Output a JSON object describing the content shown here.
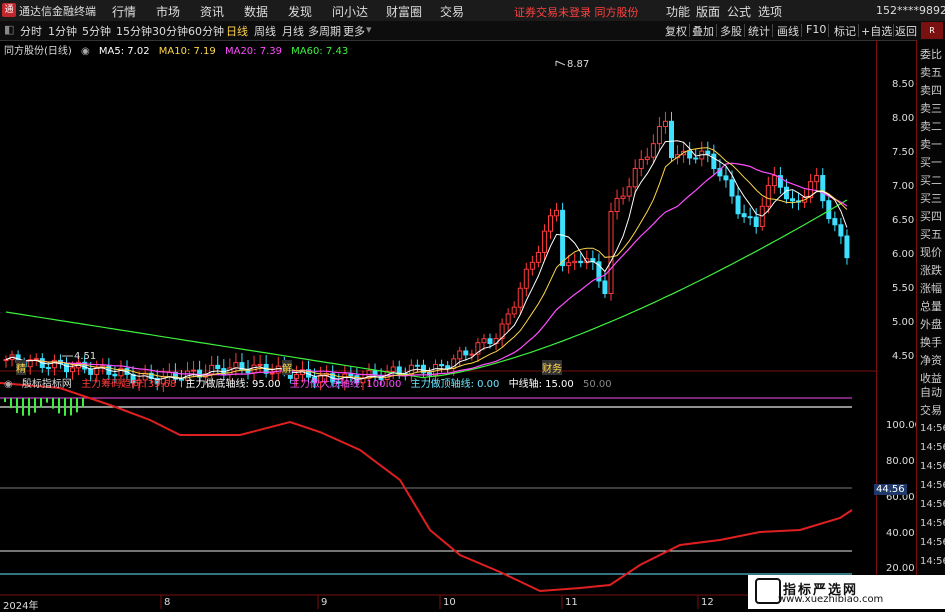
{
  "titlebar": {
    "logo": "通",
    "app_name": "通达信金融终端",
    "menus": [
      "行情",
      "市场",
      "资讯",
      "数据",
      "发现",
      "问小达",
      "财富圈",
      "交易"
    ],
    "warning": "证券交易未登录  同方股份",
    "right_menus": [
      "功能",
      "版面",
      "公式",
      "选项"
    ],
    "user": "152****9892"
  },
  "toolbar": {
    "periods": [
      "分时",
      "1分钟",
      "5分钟",
      "15分钟",
      "30分钟",
      "60分钟",
      "日线",
      "周线",
      "月线",
      "多周期",
      "更多"
    ],
    "active_period": "日线",
    "right_items": [
      "复权",
      "叠加",
      "多股",
      "统计",
      "画线",
      "F10",
      "标记",
      "+自选",
      "返回"
    ]
  },
  "main_chart": {
    "stock": "同方股份(日线)",
    "ma": [
      {
        "label": "MA5: 7.02",
        "color": "#ffffff"
      },
      {
        "label": "MA10: 7.19",
        "color": "#ffd84a"
      },
      {
        "label": "MA20: 7.39",
        "color": "#ff4dff"
      },
      {
        "label": "MA60: 7.43",
        "color": "#3ef03e"
      }
    ],
    "high_label": "8.87",
    "low_label": "4.51",
    "event_labels": [
      "精",
      "解",
      "财务"
    ],
    "price_axis": [
      "8.50",
      "8.00",
      "7.50",
      "7.00",
      "6.50",
      "6.00",
      "5.50",
      "5.00",
      "4.50"
    ]
  },
  "indicator": {
    "name": "殷标指标网",
    "items": [
      {
        "label": "主力筹码趋向: 39.68",
        "color": "#ff3b3b"
      },
      {
        "label": "主力做底轴线: 95.00",
        "color": "#ffffff"
      },
      {
        "label": "主力做大底轴线: 100.00",
        "color": "#ff4dff"
      },
      {
        "label": "主力做顶轴线: 0.00",
        "color": "#6be6ff"
      },
      {
        "label": "中线轴: 15.00",
        "color": "#ffffff"
      },
      {
        "label": "50.00",
        "color": "#888888"
      }
    ],
    "axis": [
      "100.00",
      "80.00",
      "60.00",
      "40.00",
      "20.00"
    ],
    "current_value": "44.56"
  },
  "date_axis": [
    "2024年",
    "8",
    "9",
    "10",
    "11",
    "12"
  ],
  "right_panel": {
    "top_badge": "R",
    "items": [
      "委比",
      "卖五",
      "卖四",
      "卖三",
      "卖二",
      "卖一",
      "买一",
      "买二",
      "买三",
      "买四",
      "买五",
      "现价",
      "涨跌",
      "涨幅",
      "总量",
      "外盘",
      "换手",
      "净资",
      "收益",
      "自动",
      "交易"
    ],
    "times": [
      "14:56",
      "14:56",
      "14:56",
      "14:56",
      "14:56",
      "14:56",
      "14:56",
      "14:56"
    ]
  },
  "watermark": {
    "title": "指标严选网",
    "url": "www.xuezhibiao.com"
  },
  "colors": {
    "up": "#ff3b3b",
    "down": "#3ee0ff",
    "ma5": "#ffffff",
    "ma10": "#ffd84a",
    "ma20": "#ff4dff",
    "ma60": "#3ef03e",
    "indicator_line": "#e02020"
  }
}
